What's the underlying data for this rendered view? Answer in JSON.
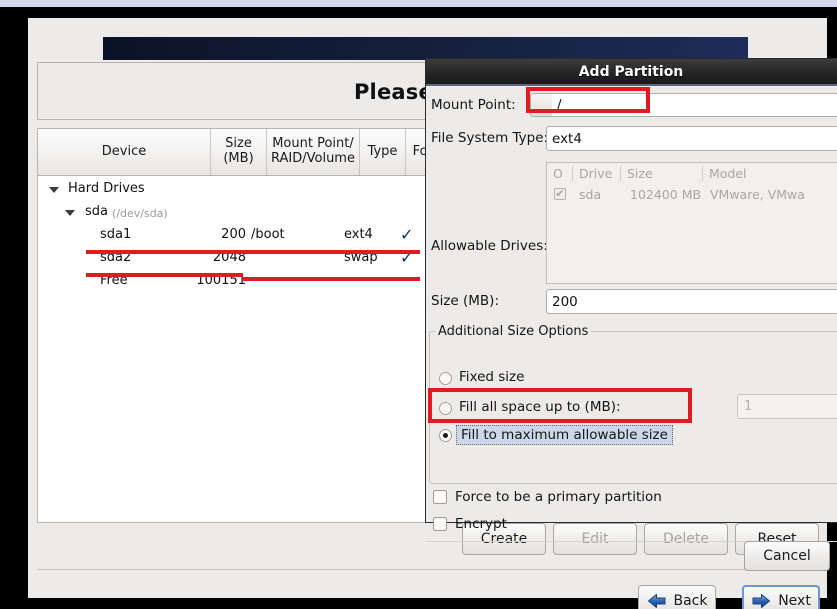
{
  "window": {
    "title": "Please Sele"
  },
  "table": {
    "columns": [
      {
        "label": "Device"
      },
      {
        "label": "Size\n(MB)"
      },
      {
        "label": "Mount Point/\nRAID/Volume"
      },
      {
        "label": "Type"
      },
      {
        "label": "Format"
      }
    ],
    "col_device": "Device",
    "col_size_l1": "Size",
    "col_size_l2": "(MB)",
    "col_mount_l1": "Mount Point/",
    "col_mount_l2": "RAID/Volume",
    "col_type": "Type",
    "col_format": "Format",
    "rows": [
      {
        "device": "Hard Drives",
        "size": "",
        "mount": "",
        "type": "",
        "format": ""
      },
      {
        "device": "sda",
        "dev_note": "(/dev/sda)",
        "size": "",
        "mount": "",
        "type": "",
        "format": ""
      },
      {
        "device": "sda1",
        "size": "200",
        "mount": "/boot",
        "type": "ext4",
        "format": "✓"
      },
      {
        "device": "sda2",
        "size": "2048",
        "mount": "",
        "type": "swap",
        "format": "✓"
      },
      {
        "device": "Free",
        "size": "100151",
        "mount": "",
        "type": "",
        "format": ""
      }
    ]
  },
  "action_buttons": {
    "create": "Create",
    "edit": "Edit",
    "delete": "Delete",
    "reset": "Reset"
  },
  "nav": {
    "back": "Back",
    "next": "Next"
  },
  "dialog": {
    "title": "Add Partition",
    "mount_point_label": "Mount Point:",
    "mount_point_value": "/",
    "fs_type_label": "File System Type:",
    "fs_type_value": "ext4",
    "allowable_drives_label": "Allowable Drives:",
    "drive_table": {
      "col_check": "O",
      "col_drive": "Drive",
      "col_size": "Size",
      "col_model": "Model",
      "rows": [
        {
          "checked": "✔",
          "drive": "sda",
          "size": "102400 MB",
          "model": "VMware, VMwa"
        }
      ]
    },
    "size_label": "Size (MB):",
    "size_value": "200",
    "group_title": "Additional Size Options",
    "radio_fixed": "Fixed size",
    "radio_fill_up_to": "Fill all space up to (MB):",
    "fill_up_to_value": "1",
    "radio_fill_max": "Fill to maximum allowable size",
    "selected_size_option": "fill_max",
    "cb_primary": "Force to be a primary partition",
    "cb_encrypt": "Encrypt",
    "cancel": "Cancel"
  },
  "annotations": {
    "color": "#e11b22",
    "boxes": [
      "mount-point-field",
      "fill-to-maximum-radio"
    ],
    "underlines": [
      "sda1-row",
      "sda2-row"
    ]
  },
  "colors": {
    "accent_blue": "#1d2c59",
    "annotation_red": "#e11b22",
    "window_bg": "#edebe9"
  }
}
